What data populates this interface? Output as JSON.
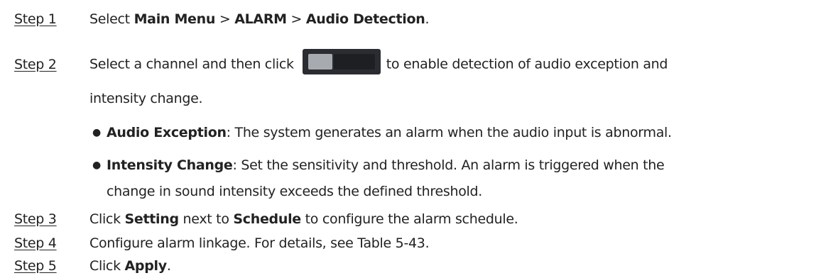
{
  "steps": [
    {
      "label": "Step 1",
      "parts": [
        "Select ",
        "Main Menu",
        " > ",
        "ALARM",
        " > ",
        "Audio Detection",
        "."
      ]
    },
    {
      "label": "Step 2",
      "before_toggle": "Select a channel and then click",
      "after_toggle": "to enable detection of audio exception and",
      "continuation": "intensity change."
    },
    {
      "label": "Step 3",
      "parts": [
        "Click ",
        "Setting",
        " next to ",
        "Schedule",
        " to configure the alarm schedule."
      ]
    },
    {
      "label": "Step 4",
      "text": "Configure alarm linkage. For details, see Table 5-43."
    },
    {
      "label": "Step 5",
      "parts": [
        "Click ",
        "Apply",
        "."
      ]
    }
  ],
  "bullets": [
    {
      "term": "Audio Exception",
      "text": ": The system generates an alarm when the audio input is abnormal."
    },
    {
      "term": "Intensity Change",
      "text": ": Set the sensitivity and threshold. An alarm is triggered when the",
      "continuation": "change in sound intensity exceeds the defined threshold."
    }
  ],
  "bullet_symbol": "●",
  "toggle": {
    "icon": "toggle-switch-icon",
    "state": "off",
    "colors": {
      "body": "#2a2c31",
      "knob": "#a7abb0",
      "track": "#1d1f23"
    }
  }
}
